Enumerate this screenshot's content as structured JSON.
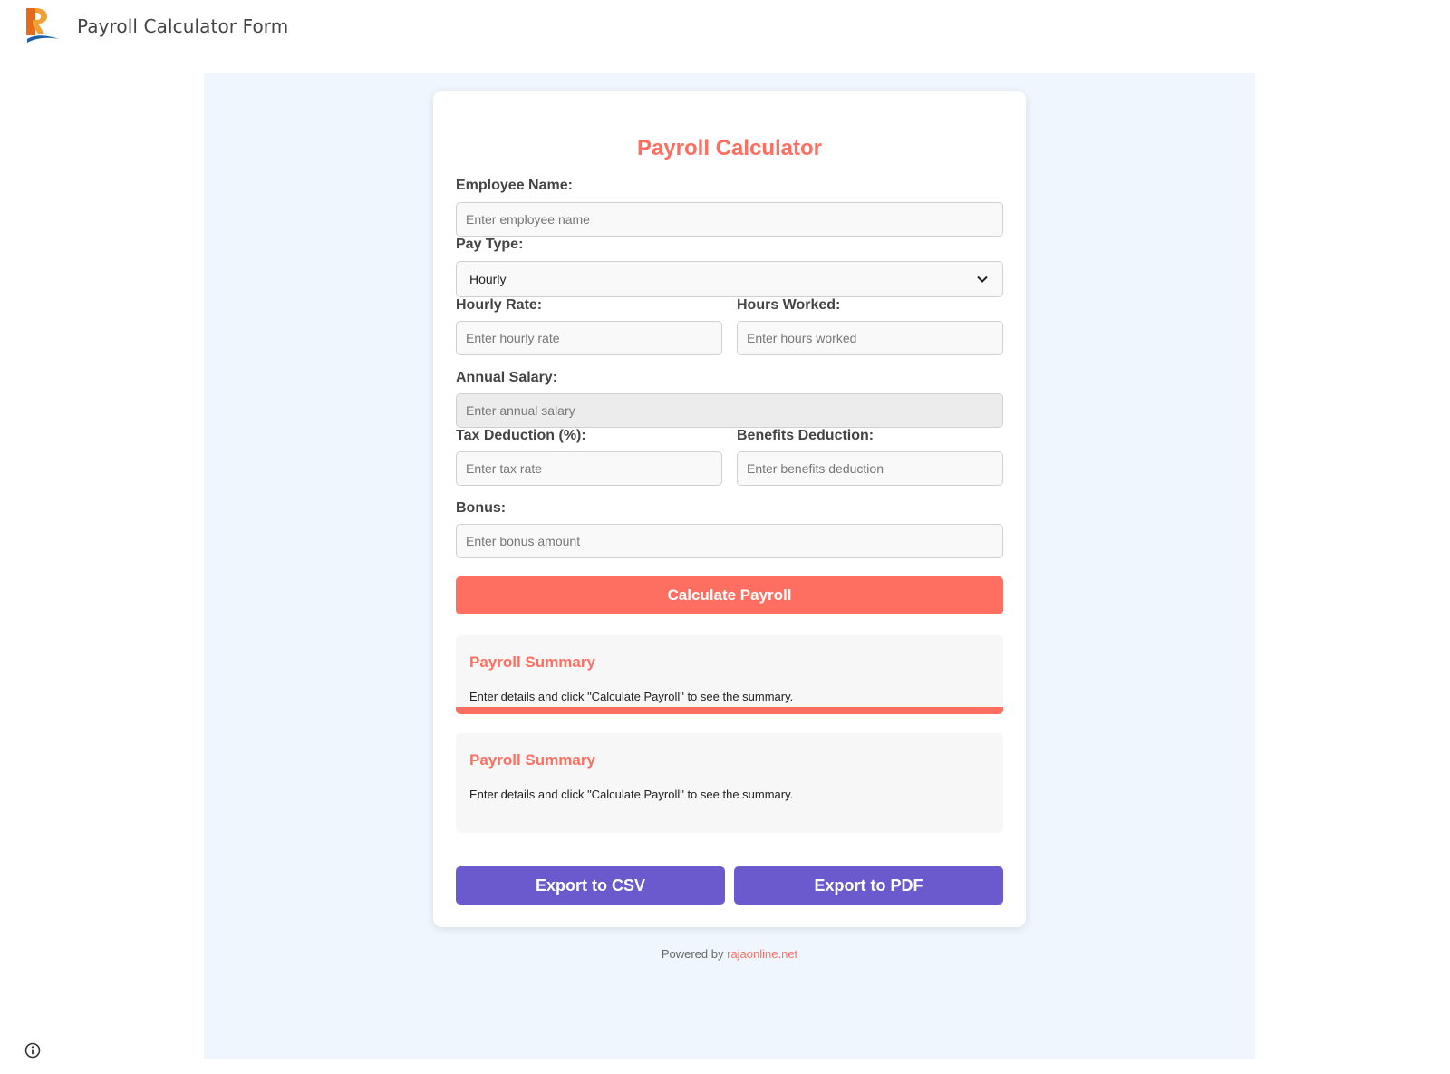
{
  "app": {
    "title": "Payroll Calculator Form"
  },
  "form": {
    "title": "Payroll Calculator",
    "employee_name": {
      "label": "Employee Name:",
      "placeholder": "Enter employee name",
      "value": ""
    },
    "pay_type": {
      "label": "Pay Type:",
      "selected": "Hourly"
    },
    "hourly_rate": {
      "label": "Hourly Rate:",
      "placeholder": "Enter hourly rate",
      "value": ""
    },
    "hours_worked": {
      "label": "Hours Worked:",
      "placeholder": "Enter hours worked",
      "value": ""
    },
    "annual_salary": {
      "label": "Annual Salary:",
      "placeholder": "Enter annual salary",
      "value": ""
    },
    "tax_deduction": {
      "label": "Tax Deduction (%):",
      "placeholder": "Enter tax rate",
      "value": ""
    },
    "benefits_deduction": {
      "label": "Benefits Deduction:",
      "placeholder": "Enter benefits deduction",
      "value": ""
    },
    "bonus": {
      "label": "Bonus:",
      "placeholder": "Enter bonus amount",
      "value": ""
    },
    "calculate_label": "Calculate Payroll"
  },
  "summaries": [
    {
      "title": "Payroll Summary",
      "text": "Enter details and click \"Calculate Payroll\" to see the summary."
    },
    {
      "title": "Payroll Summary",
      "text": "Enter details and click \"Calculate Payroll\" to see the summary."
    }
  ],
  "exports": {
    "csv_label": "Export to CSV",
    "pdf_label": "Export to PDF"
  },
  "footer": {
    "prefix": "Powered by",
    "link_text": "rajaonline.net"
  },
  "colors": {
    "accent": "#ff6f61",
    "export": "#6a5acd",
    "canvas": "#f0f6fd"
  },
  "icons": {
    "logo": "brand-logo",
    "select": "chevron-down-icon",
    "info": "info-icon"
  }
}
